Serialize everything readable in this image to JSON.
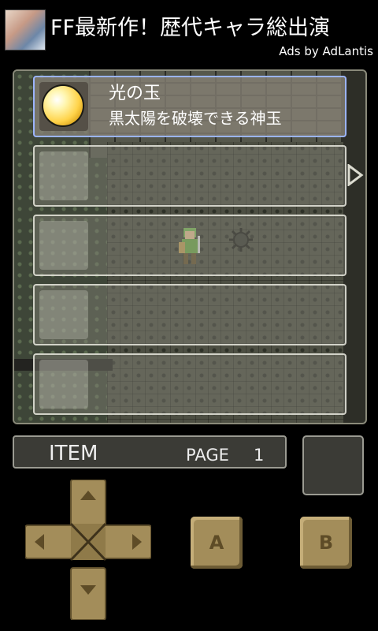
{
  "ad": {
    "title": "FF最新作！歴代キャラ総出演",
    "attribution": "Ads by AdLantis"
  },
  "inventory": {
    "slots": [
      {
        "name": "光の玉",
        "description": "黒太陽を破壊できる神玉",
        "icon": "light-orb-icon",
        "selected": true
      },
      {
        "name": "",
        "description": "",
        "icon": "",
        "selected": false
      },
      {
        "name": "",
        "description": "",
        "icon": "",
        "selected": false
      },
      {
        "name": "",
        "description": "",
        "icon": "",
        "selected": false
      },
      {
        "name": "",
        "description": "",
        "icon": "",
        "selected": false
      }
    ]
  },
  "status": {
    "mode_label": "ITEM",
    "page_label": "PAGE",
    "page_number": "1"
  },
  "controls": {
    "a_label": "A",
    "b_label": "B"
  },
  "colors": {
    "selected_border": "#9bb4ff",
    "button_tan": "#a38d5a"
  }
}
